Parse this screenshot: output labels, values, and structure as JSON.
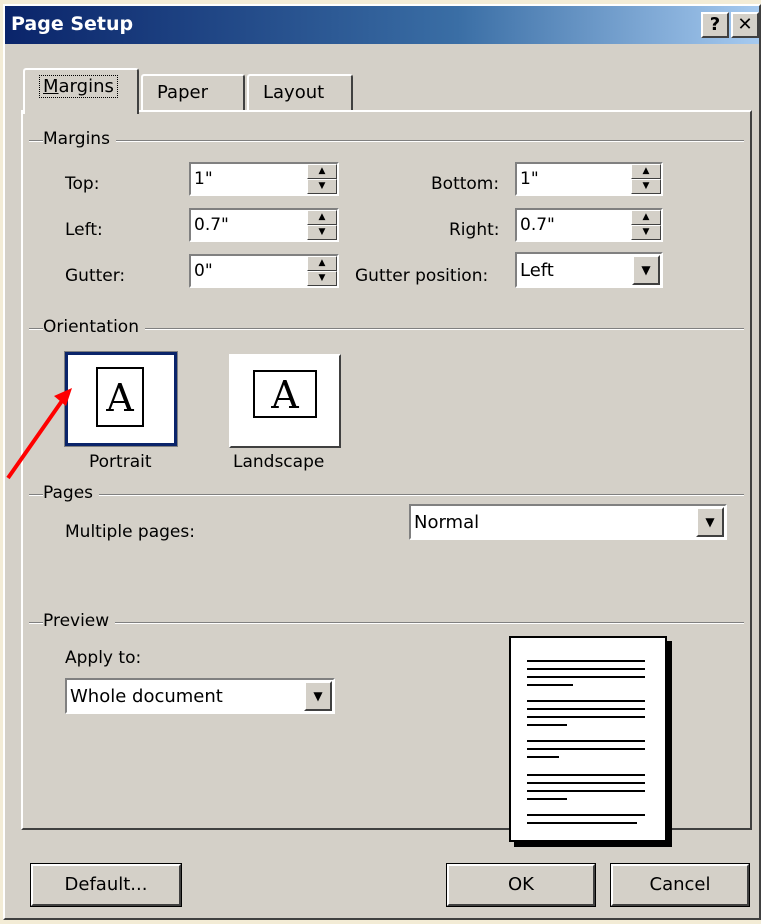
{
  "window": {
    "title": "Page Setup",
    "help_label": "?",
    "close_label": "✕"
  },
  "tabs": [
    {
      "label": "Margins"
    },
    {
      "label": "Paper"
    },
    {
      "label": "Layout"
    }
  ],
  "margins": {
    "group_label": "Margins",
    "top_label": "Top:",
    "top_value": "1\"",
    "bottom_label": "Bottom:",
    "bottom_value": "1\"",
    "left_label": "Left:",
    "left_value": "0.7\"",
    "right_label": "Right:",
    "right_value": "0.7\"",
    "gutter_label": "Gutter:",
    "gutter_value": "0\"",
    "gutter_position_label": "Gutter position:",
    "gutter_position_value": "Left"
  },
  "orientation": {
    "group_label": "Orientation",
    "portrait_label": "Portrait",
    "landscape_label": "Landscape",
    "icon_letter": "A",
    "selected": "portrait"
  },
  "pages": {
    "group_label": "Pages",
    "multiple_pages_label": "Multiple pages:",
    "multiple_pages_value": "Normal"
  },
  "preview": {
    "group_label": "Preview",
    "apply_to_label": "Apply to:",
    "apply_to_value": "Whole document"
  },
  "buttons": {
    "default_label": "Default...",
    "ok_label": "OK",
    "cancel_label": "Cancel"
  },
  "colors": {
    "face": "#d4d0c8",
    "title_start": "#0a246a",
    "title_end": "#a6caf0",
    "annotation_arrow": "#ff0000"
  }
}
